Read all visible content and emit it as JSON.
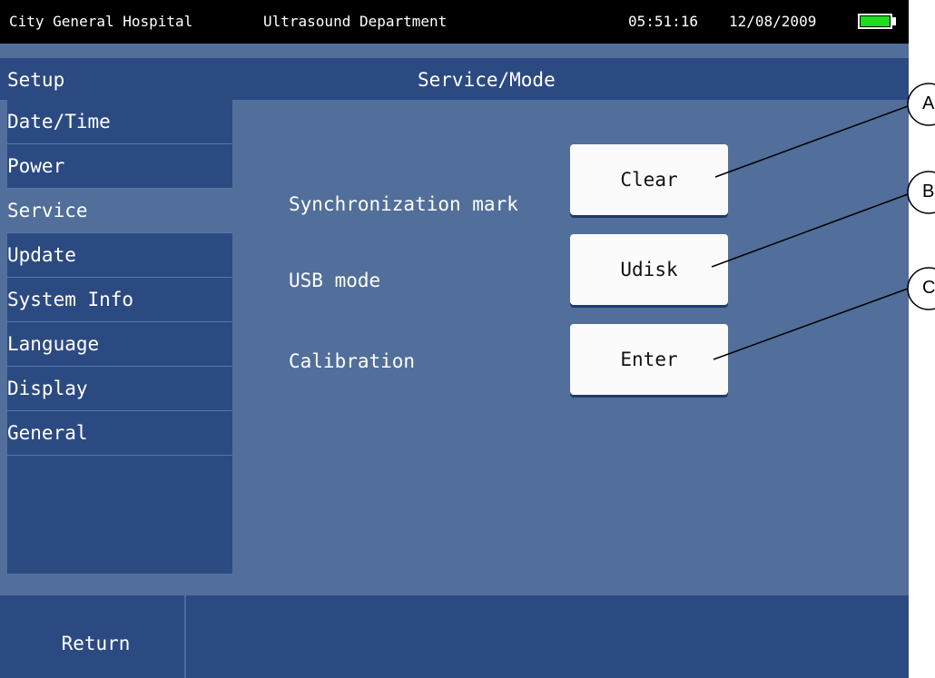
{
  "status_bar": {
    "hospital": "City General Hospital",
    "department": "Ultrasound Department",
    "time": "05:51:16",
    "date": "12/08/2009",
    "battery_icon": "battery-full-icon",
    "battery_color": "#1fdc1f"
  },
  "header": {
    "setup_label": "Setup",
    "title": "Service/Mode"
  },
  "sidebar": {
    "items": [
      {
        "label": "Date/Time"
      },
      {
        "label": "Power"
      },
      {
        "label": "Service",
        "selected": true
      },
      {
        "label": "Update"
      },
      {
        "label": "System Info"
      },
      {
        "label": "Language"
      },
      {
        "label": "Display"
      },
      {
        "label": "General"
      }
    ]
  },
  "settings": [
    {
      "label": "Synchronization mark",
      "button": "Clear"
    },
    {
      "label": "USB mode",
      "button": "Udisk"
    },
    {
      "label": "Calibration",
      "button": "Enter"
    }
  ],
  "callouts": [
    "A",
    "B",
    "C"
  ],
  "footer": {
    "return_label": "Return"
  },
  "colors": {
    "panel_bg": "#516f9a",
    "bar_bg": "#2c4a82",
    "status_bg": "#000000"
  }
}
